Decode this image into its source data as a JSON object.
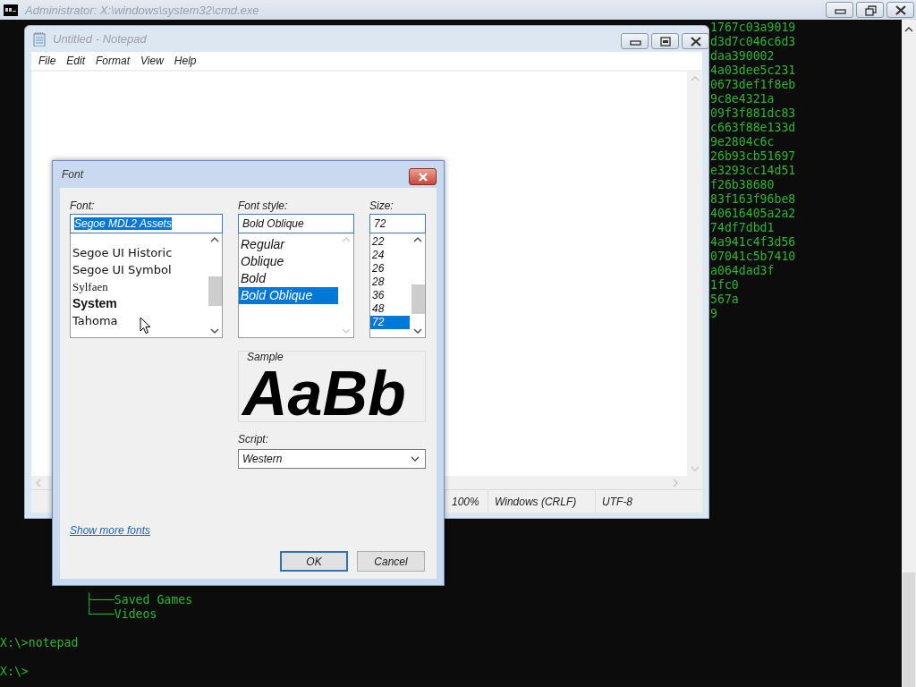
{
  "console_window": {
    "title": "Administrator: X:\\windows\\system32\\cmd.exe",
    "right_lines": [
      "1767c03a9019",
      "d3d7c046c6d3",
      "daa390002",
      "4a03dee5c231",
      "0673def1f8eb",
      "9c8e4321a",
      "09f3f881dc83",
      "c663f88e133d",
      "9e2804c6c",
      "26b93cb51697",
      "e3293cc14d51",
      "f26b38680",
      "83f163f96be8",
      "40616405a2a2",
      "74df7dbd1",
      "4a941c4f3d56",
      "07041c5b7410",
      "a064dad3f",
      "1fc0",
      "567a",
      "9"
    ],
    "bottom_lines": [
      {
        "kind": "tree",
        "text": "├───Saved Games"
      },
      {
        "kind": "tree",
        "text": "└───Videos"
      },
      {
        "kind": "prompt",
        "text": "X:\\>notepad"
      },
      {
        "kind": "prompt",
        "text": "X:\\>"
      }
    ]
  },
  "notepad": {
    "title": "Untitled - Notepad",
    "menu": [
      "File",
      "Edit",
      "Format",
      "View",
      "Help"
    ],
    "status_bar": [
      "100%",
      "Windows (CRLF)",
      "UTF-8"
    ]
  },
  "font_dialog": {
    "title": "Font",
    "font": {
      "label": "Font:",
      "value": "Segoe MDL2 Assets",
      "value_selected": true,
      "items": [
        {
          "text": "Segoe UI Historic",
          "kind": "sans",
          "selected": false
        },
        {
          "text": "Segoe UI Symbol",
          "kind": "sans",
          "selected": false
        },
        {
          "text": "Sylfaen",
          "kind": "serif",
          "selected": false
        },
        {
          "text": "System",
          "kind": "bold",
          "selected": false
        },
        {
          "text": "Tahoma",
          "kind": "sans",
          "selected": false
        }
      ]
    },
    "style": {
      "label": "Font style:",
      "value": "Bold Oblique",
      "value_selected": false,
      "items": [
        {
          "text": "Regular",
          "selected": false
        },
        {
          "text": "Oblique",
          "selected": false
        },
        {
          "text": "Bold",
          "selected": false
        },
        {
          "text": "Bold Oblique",
          "selected": true
        }
      ]
    },
    "size": {
      "label": "Size:",
      "value": "72",
      "value_selected": false,
      "items": [
        {
          "text": "22",
          "selected": false
        },
        {
          "text": "24",
          "selected": false
        },
        {
          "text": "26",
          "selected": false
        },
        {
          "text": "28",
          "selected": false
        },
        {
          "text": "36",
          "selected": false
        },
        {
          "text": "48",
          "selected": false
        },
        {
          "text": "72",
          "selected": true
        }
      ]
    },
    "sample": {
      "label": "Sample",
      "text": "AaBb"
    },
    "script": {
      "label": "Script:",
      "value": "Western"
    },
    "link": "Show more fonts",
    "buttons": [
      {
        "label": "OK",
        "default": true
      },
      {
        "label": "Cancel",
        "default": false
      }
    ]
  }
}
